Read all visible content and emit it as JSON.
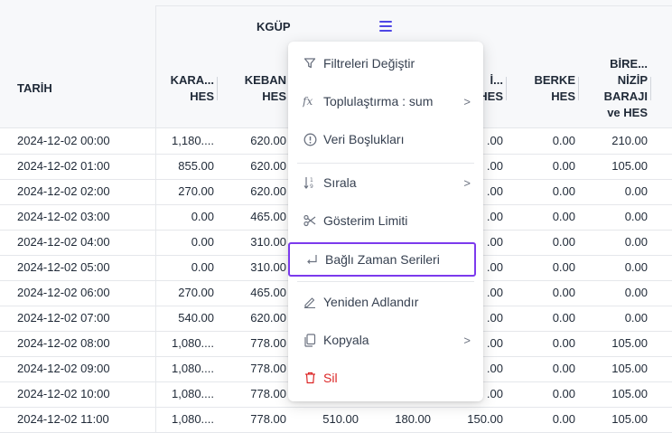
{
  "grid": {
    "group_header": "KGÜP",
    "columns": [
      {
        "label_lines": [
          "TARİH"
        ]
      },
      {
        "label_lines": [
          "KARA...",
          "HES"
        ]
      },
      {
        "label_lines": [
          "KEBAN",
          "HES"
        ]
      },
      {
        "label_lines": [
          ""
        ]
      },
      {
        "label_lines": [
          ""
        ]
      },
      {
        "label_lines": [
          "İ...",
          "HES"
        ]
      },
      {
        "label_lines": [
          "BERKE",
          "HES"
        ]
      },
      {
        "label_lines": [
          "BİRE...",
          "NİZİP",
          "BARAJI",
          "ve HES"
        ]
      }
    ],
    "rows": [
      [
        "2024-12-02 00:00",
        "1,180....",
        "620.00",
        "",
        "",
        ".00",
        "0.00",
        "210.00"
      ],
      [
        "2024-12-02 01:00",
        "855.00",
        "620.00",
        "",
        "",
        ".00",
        "0.00",
        "105.00"
      ],
      [
        "2024-12-02 02:00",
        "270.00",
        "620.00",
        "",
        "",
        ".00",
        "0.00",
        "0.00"
      ],
      [
        "2024-12-02 03:00",
        "0.00",
        "465.00",
        "",
        "",
        ".00",
        "0.00",
        "0.00"
      ],
      [
        "2024-12-02 04:00",
        "0.00",
        "310.00",
        "",
        "",
        ".00",
        "0.00",
        "0.00"
      ],
      [
        "2024-12-02 05:00",
        "0.00",
        "310.00",
        "",
        "",
        ".00",
        "0.00",
        "0.00"
      ],
      [
        "2024-12-02 06:00",
        "270.00",
        "465.00",
        "",
        "",
        ".00",
        "0.00",
        "0.00"
      ],
      [
        "2024-12-02 07:00",
        "540.00",
        "620.00",
        "",
        "",
        ".00",
        "0.00",
        "0.00"
      ],
      [
        "2024-12-02 08:00",
        "1,080....",
        "778.00",
        "",
        "",
        ".00",
        "0.00",
        "105.00"
      ],
      [
        "2024-12-02 09:00",
        "1,080....",
        "778.00",
        "",
        "",
        ".00",
        "0.00",
        "105.00"
      ],
      [
        "2024-12-02 10:00",
        "1,080....",
        "778.00",
        "",
        "",
        ".00",
        "0.00",
        "105.00"
      ],
      [
        "2024-12-02 11:00",
        "1,080....",
        "778.00",
        "510.00",
        "180.00",
        "150.00",
        "0.00",
        "105.00"
      ]
    ]
  },
  "menu": {
    "items": [
      {
        "label": "Filtreleri Değiştir",
        "icon": "filter-icon",
        "submenu": false
      },
      {
        "label": "Toplulaştırma : sum",
        "icon": "fx-icon",
        "submenu": true
      },
      {
        "label": "Veri Boşlukları",
        "icon": "info-circle-icon",
        "submenu": false
      },
      {
        "label": "Sırala",
        "icon": "sort-icon",
        "submenu": true
      },
      {
        "label": "Gösterim Limiti",
        "icon": "scissors-icon",
        "submenu": false
      },
      {
        "label": "Bağlı Zaman Serileri",
        "icon": "link-return-icon",
        "submenu": false,
        "highlighted": true
      },
      {
        "label": "Yeniden Adlandır",
        "icon": "pencil-icon",
        "submenu": false
      },
      {
        "label": "Kopyala",
        "icon": "copy-icon",
        "submenu": true
      },
      {
        "label": "Sil",
        "icon": "trash-icon",
        "submenu": false,
        "danger": true
      }
    ],
    "submenu_arrow": ">"
  },
  "colors": {
    "accent": "#4f46e5",
    "highlight": "#7c3aed",
    "danger": "#dc2626",
    "icon": "#6b7280"
  }
}
